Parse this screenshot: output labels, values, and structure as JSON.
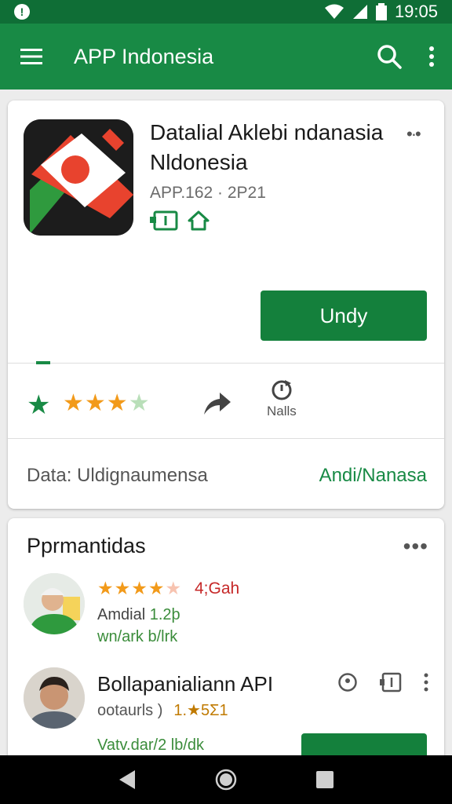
{
  "status_bar": {
    "time": "19:05",
    "notification_icon": "notification-icon",
    "icons": [
      "wifi-icon",
      "signal-icon",
      "battery-icon"
    ]
  },
  "app_bar": {
    "title": "APP Indonesia",
    "menu_icon": "hamburger-menu-icon",
    "search_icon": "search-icon",
    "more_icon": "more-vert-icon"
  },
  "app_detail": {
    "name": "Datalial Aklebi ndanasia Nldonesia",
    "meta": "APP.162 · 2P21",
    "badges": [
      "badge-icon",
      "home-icon"
    ],
    "install_label": "Undy",
    "rating_stars": 4.5,
    "reviews_label": "Nalls",
    "data_label": "Data: Uldignaumensa",
    "data_link": "Andi/Nanasa"
  },
  "reviews": {
    "title": "Pprmantidas",
    "items": [
      {
        "rating": "4;Gah",
        "stars": 4.5,
        "line1_prefix": "Amdial",
        "line1_value": "1.2þ",
        "line2": "wn/ark b/lrk"
      },
      {
        "title": "Bollapanialiann API",
        "sub": "ootaurls )",
        "rate": "1.★5Σ1",
        "line3": "Vatv.dar/2 lb/dk"
      }
    ]
  },
  "nav_bar": {
    "icons": [
      "back-icon",
      "home-icon",
      "recents-icon"
    ]
  },
  "colors": {
    "primary": "#188a45",
    "primary_dark": "#0f6e36",
    "button": "#14803c",
    "star": "#f29a1a"
  }
}
